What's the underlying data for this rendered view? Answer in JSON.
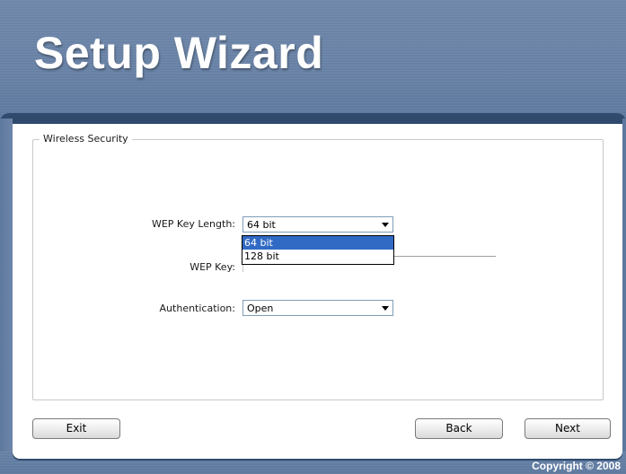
{
  "window": {
    "title": "Setup Wizard",
    "copyright": "Copyright © 2008"
  },
  "group": {
    "legend": "Wireless Security"
  },
  "wep_key_length": {
    "label": "WEP Key Length:",
    "selected": "64 bit",
    "options": [
      "64 bit",
      "128 bit"
    ]
  },
  "wep_key": {
    "label": "WEP Key:",
    "value": ""
  },
  "authentication": {
    "label": "Authentication:",
    "selected": "Open"
  },
  "buttons": {
    "exit": "Exit",
    "back": "Back",
    "next": "Next"
  },
  "icons": {
    "dropdown_arrow": "chevron-down-icon"
  },
  "colors": {
    "header": "#6781a5",
    "band": "#2f4a6d",
    "selection": "#316ac5"
  }
}
